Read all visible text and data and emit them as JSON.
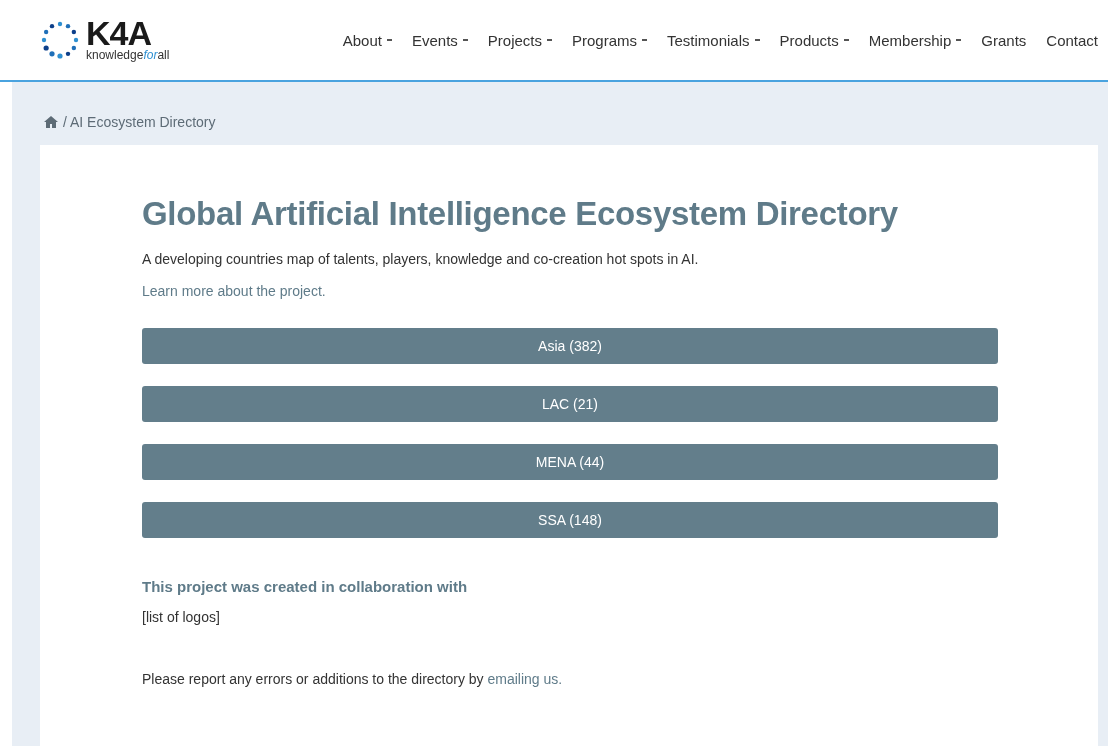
{
  "logo": {
    "name": "K4A",
    "tagline": {
      "start": "knowledge",
      "accent": "for",
      "end": "all"
    }
  },
  "nav": [
    {
      "label": "About",
      "dropdown": true
    },
    {
      "label": "Events",
      "dropdown": true
    },
    {
      "label": "Projects",
      "dropdown": true
    },
    {
      "label": "Programs",
      "dropdown": true
    },
    {
      "label": "Testimonials",
      "dropdown": true
    },
    {
      "label": "Products",
      "dropdown": true
    },
    {
      "label": "Membership",
      "dropdown": true
    },
    {
      "label": "Grants",
      "dropdown": false
    },
    {
      "label": "Contact",
      "dropdown": false
    }
  ],
  "breadcrumb": {
    "current": "/ AI Ecosystem Directory"
  },
  "title": "Global Artificial Intelligence Ecosystem Directory",
  "subtitle": "A developing countries map of talents, players, knowledge and co-creation hot spots in AI.",
  "learn_more": "Learn more about the project.",
  "regions": [
    {
      "label": "Asia (382)"
    },
    {
      "label": "LAC (21)"
    },
    {
      "label": "MENA (44)"
    },
    {
      "label": "SSA (148)"
    }
  ],
  "collaboration": {
    "heading": "This project was created in collaboration with",
    "logos": "[list of logos]"
  },
  "report": {
    "text": "Please report any errors or additions to the directory by ",
    "link": "emailing us."
  }
}
